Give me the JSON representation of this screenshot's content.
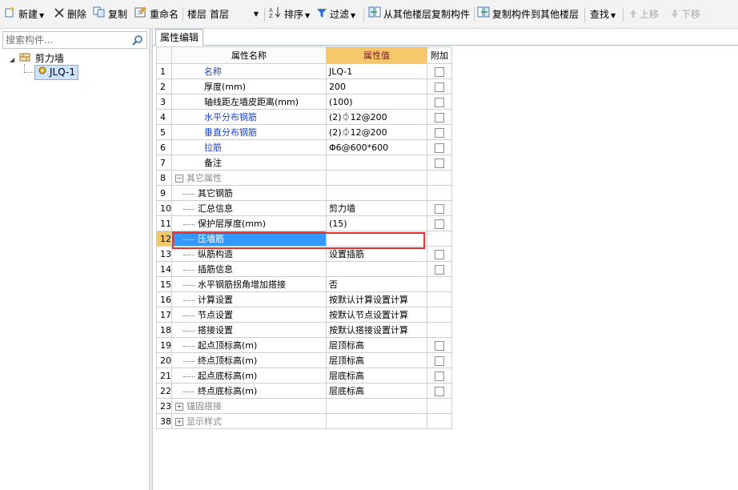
{
  "toolbar": {
    "new": "新建",
    "delete": "删除",
    "copy": "复制",
    "rename": "重命名",
    "floor_label": "楼层",
    "floor_value": "首层",
    "sort": "排序",
    "filter": "过滤",
    "copy_from_other": "从其他楼层复制构件",
    "copy_to_other": "复制构件到其他楼层",
    "find": "查找",
    "move_up": "上移",
    "move_down": "下移"
  },
  "search": {
    "placeholder": "搜索构件..."
  },
  "tree": {
    "root": "剪力墙",
    "child": "JLQ-1"
  },
  "tab": "属性编辑",
  "grid": {
    "headers": {
      "name": "属性名称",
      "value": "属性值",
      "attach": "附加"
    },
    "rows": [
      {
        "no": "1",
        "name": "名称",
        "value": "JLQ-1"
      },
      {
        "no": "2",
        "name": "厚度(mm)",
        "value": "200"
      },
      {
        "no": "3",
        "name": "轴线距左墙皮距离(mm)",
        "value": "(100)"
      },
      {
        "no": "4",
        "name": "水平分布钢筋",
        "value": "(2)⏀12@200"
      },
      {
        "no": "5",
        "name": "垂直分布钢筋",
        "value": "(2)⏀12@200"
      },
      {
        "no": "6",
        "name": "拉筋",
        "value": "Φ6@600*600"
      },
      {
        "no": "7",
        "name": "备注",
        "value": ""
      },
      {
        "no": "8",
        "name": "其它属性",
        "value": ""
      },
      {
        "no": "9",
        "name": "其它钢筋",
        "value": ""
      },
      {
        "no": "10",
        "name": "汇总信息",
        "value": "剪力墙"
      },
      {
        "no": "11",
        "name": "保护层厚度(mm)",
        "value": "(15)"
      },
      {
        "no": "12",
        "name": "压墙筋",
        "value": ""
      },
      {
        "no": "13",
        "name": "纵筋构造",
        "value": "设置插筋"
      },
      {
        "no": "14",
        "name": "插筋信息",
        "value": ""
      },
      {
        "no": "15",
        "name": "水平钢筋拐角增加搭接",
        "value": "否"
      },
      {
        "no": "16",
        "name": "计算设置",
        "value": "按默认计算设置计算"
      },
      {
        "no": "17",
        "name": "节点设置",
        "value": "按默认节点设置计算"
      },
      {
        "no": "18",
        "name": "搭接设置",
        "value": "按默认搭接设置计算"
      },
      {
        "no": "19",
        "name": "起点顶标高(m)",
        "value": "层顶标高"
      },
      {
        "no": "20",
        "name": "终点顶标高(m)",
        "value": "层顶标高"
      },
      {
        "no": "21",
        "name": "起点底标高(m)",
        "value": "层底标高"
      },
      {
        "no": "22",
        "name": "终点底标高(m)",
        "value": "层底标高"
      },
      {
        "no": "23",
        "name": "锚固搭接",
        "value": ""
      },
      {
        "no": "38",
        "name": "显示样式",
        "value": ""
      }
    ]
  },
  "colors": {
    "value_header": "#f7c76d",
    "selection": "#3399ff",
    "highlight_box": "#e8302c",
    "link_text": "#1a3fd0"
  }
}
